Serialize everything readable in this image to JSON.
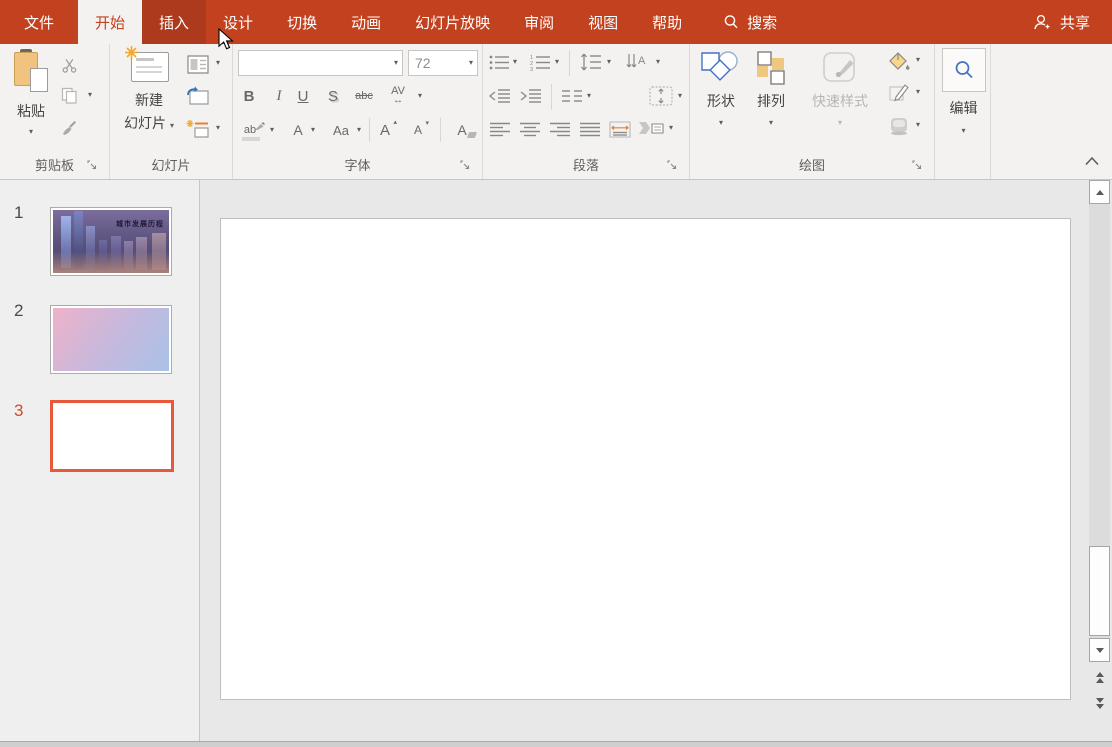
{
  "menu": {
    "tabs": [
      {
        "label": "文件",
        "state": "file"
      },
      {
        "label": "开始",
        "state": "selected"
      },
      {
        "label": "插入",
        "state": "hovered"
      },
      {
        "label": "设计",
        "state": "normal"
      },
      {
        "label": "切换",
        "state": "normal"
      },
      {
        "label": "动画",
        "state": "normal"
      },
      {
        "label": "幻灯片放映",
        "state": "normal"
      },
      {
        "label": "审阅",
        "state": "normal"
      },
      {
        "label": "视图",
        "state": "normal"
      },
      {
        "label": "帮助",
        "state": "normal"
      }
    ],
    "search_label": "搜索",
    "share_label": "共享"
  },
  "ribbon": {
    "clipboard": {
      "paste_label": "粘贴",
      "group_label": "剪贴板"
    },
    "slides": {
      "new_slide_line1": "新建",
      "new_slide_line2": "幻灯片",
      "group_label": "幻灯片"
    },
    "font": {
      "name_value": "",
      "size_value": "72",
      "bold": "B",
      "italic": "I",
      "underline": "U",
      "shadow": "S",
      "strikethrough": "abc",
      "spacing": "AV",
      "highlight": "ab",
      "font_color": "A",
      "change_case": "Aa",
      "grow": "A",
      "shrink": "A",
      "clear": "A",
      "group_label": "字体"
    },
    "paragraph": {
      "group_label": "段落"
    },
    "drawing": {
      "shapes_label": "形状",
      "arrange_label": "排列",
      "quick_styles_label": "快速样式",
      "quick_styles_disabled": true,
      "group_label": "绘图"
    },
    "editing": {
      "edit_label": "编辑"
    }
  },
  "slide_panel": {
    "slides": [
      {
        "number": "1",
        "type": "title-image",
        "title_text": "城市发展历程",
        "selected": false
      },
      {
        "number": "2",
        "type": "gradient",
        "selected": false
      },
      {
        "number": "3",
        "type": "blank",
        "selected": true
      }
    ]
  },
  "canvas": {
    "current_slide_number": "3",
    "slide_is_blank": true
  },
  "colors": {
    "accent_red": "#C2421F",
    "tab_hover_red": "#AD3A1D",
    "selection_border_orange": "#E8593C",
    "ribbon_bg": "#F3F2F1"
  }
}
